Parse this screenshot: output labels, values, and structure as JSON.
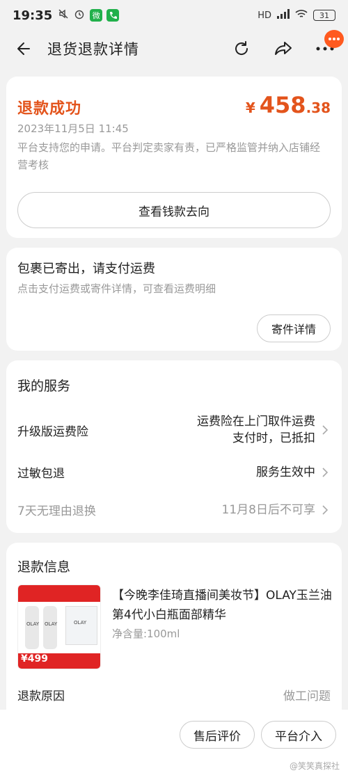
{
  "status_bar": {
    "time": "19:35",
    "battery": "31",
    "network": "HD",
    "wechat_glyph": "微",
    "icons": [
      "mute-icon",
      "alarm-icon",
      "wechat-icon",
      "call-icon",
      "signal-icon",
      "wifi-icon"
    ]
  },
  "header": {
    "title": "退货退款详情"
  },
  "refund_card": {
    "status": "退款成功",
    "currency": "¥",
    "amount_int": "458",
    "amount_dec": ".38",
    "date": "2023年11月5日 11:45",
    "description": "平台支持您的申请。平台判定卖家有责，已严格监管并纳入店铺经营考核",
    "money_button": "查看钱款去向"
  },
  "package_card": {
    "title": "包裹已寄出，请支付运费",
    "desc": "点击支付运费或寄件详情，可查看运费明细",
    "button": "寄件详情"
  },
  "services": {
    "title": "我的服务",
    "rows": [
      {
        "label": "升级版运费险",
        "value_line1": "运费险在上门取件运费",
        "value_line2": "支付时，已抵扣"
      },
      {
        "label": "过敏包退",
        "value": "服务生效中"
      },
      {
        "label": "7天无理由退换",
        "value": "11月8日后不可享"
      }
    ]
  },
  "refund_info": {
    "title": "退款信息",
    "product_name": "【今晚李佳琦直播间美妆节】OLAY玉兰油第4代小白瓶面部精华",
    "product_spec": "净含量:100ml",
    "thumb_price": "¥499",
    "reason_label": "退款原因",
    "reason_value": "做工问题"
  },
  "bottom": {
    "review_button": "售后评价",
    "platform_button": "平台介入",
    "watermark": "@笑笑真探社"
  },
  "colors": {
    "accent": "#e3541c",
    "muted": "#999999",
    "background": "#f2f2f2"
  }
}
